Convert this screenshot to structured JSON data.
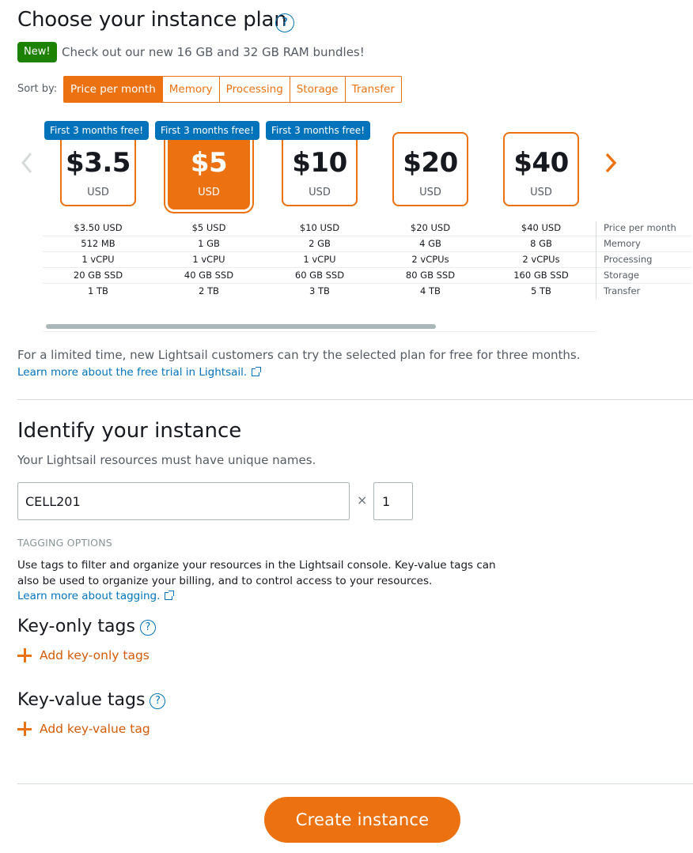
{
  "plan": {
    "title": "Choose your instance plan",
    "help_glyph": "?",
    "new_badge": "New!",
    "new_text": "Check out our new 16 GB and 32 GB RAM bundles!",
    "sort_label": "Sort by:",
    "sort_options": [
      "Price per month",
      "Memory",
      "Processing",
      "Storage",
      "Transfer"
    ],
    "selected_sort": "Price per month",
    "free_badge": "First 3 months free!",
    "cards": [
      {
        "amount": "$3.5",
        "currency": "USD",
        "free": true,
        "selected": false
      },
      {
        "amount": "$5",
        "currency": "USD",
        "free": true,
        "selected": true
      },
      {
        "amount": "$10",
        "currency": "USD",
        "free": true,
        "selected": false
      },
      {
        "amount": "$20",
        "currency": "USD",
        "free": false,
        "selected": false
      },
      {
        "amount": "$40",
        "currency": "USD",
        "free": false,
        "selected": false
      }
    ],
    "spec_labels": [
      "Price per month",
      "Memory",
      "Processing",
      "Storage",
      "Transfer"
    ],
    "specs": [
      [
        "$3.50 USD",
        "512 MB",
        "1 vCPU",
        "20 GB SSD",
        "1 TB"
      ],
      [
        "$5 USD",
        "1 GB",
        "1 vCPU",
        "40 GB SSD",
        "2 TB"
      ],
      [
        "$10 USD",
        "2 GB",
        "1 vCPU",
        "60 GB SSD",
        "3 TB"
      ],
      [
        "$20 USD",
        "4 GB",
        "2 vCPUs",
        "80 GB SSD",
        "4 TB"
      ],
      [
        "$40 USD",
        "8 GB",
        "2 vCPUs",
        "160 GB SSD",
        "5 TB"
      ]
    ],
    "free_trial_text": "For a limited time, new Lightsail customers can try the selected plan for free for three months.",
    "free_trial_link": "Learn more about the free trial in Lightsail."
  },
  "identify": {
    "title": "Identify your instance",
    "subtitle": "Your Lightsail resources must have unique names.",
    "name_value": "CELL201",
    "times_glyph": "×",
    "quantity_value": "1"
  },
  "tagging": {
    "title": "TAGGING OPTIONS",
    "description": "Use tags to filter and organize your resources in the Lightsail console. Key-value tags can also be used to organize your billing, and to control access to your resources.",
    "learn_link": "Learn more about tagging.",
    "key_only_title": "Key-only tags",
    "key_only_add": "Add key-only tags",
    "key_value_title": "Key-value tags",
    "key_value_add": "Add key-value tag"
  },
  "actions": {
    "create_label": "Create instance"
  },
  "icons": {
    "left_arrow": "chevron-left-icon",
    "right_arrow": "chevron-right-icon",
    "external_link": "external-link-icon",
    "plus": "plus-icon",
    "help": "help-icon"
  },
  "colors": {
    "accent": "#ec7211",
    "link": "#0073bb",
    "new_badge": "#1d8102",
    "free_badge": "#0073bb"
  }
}
